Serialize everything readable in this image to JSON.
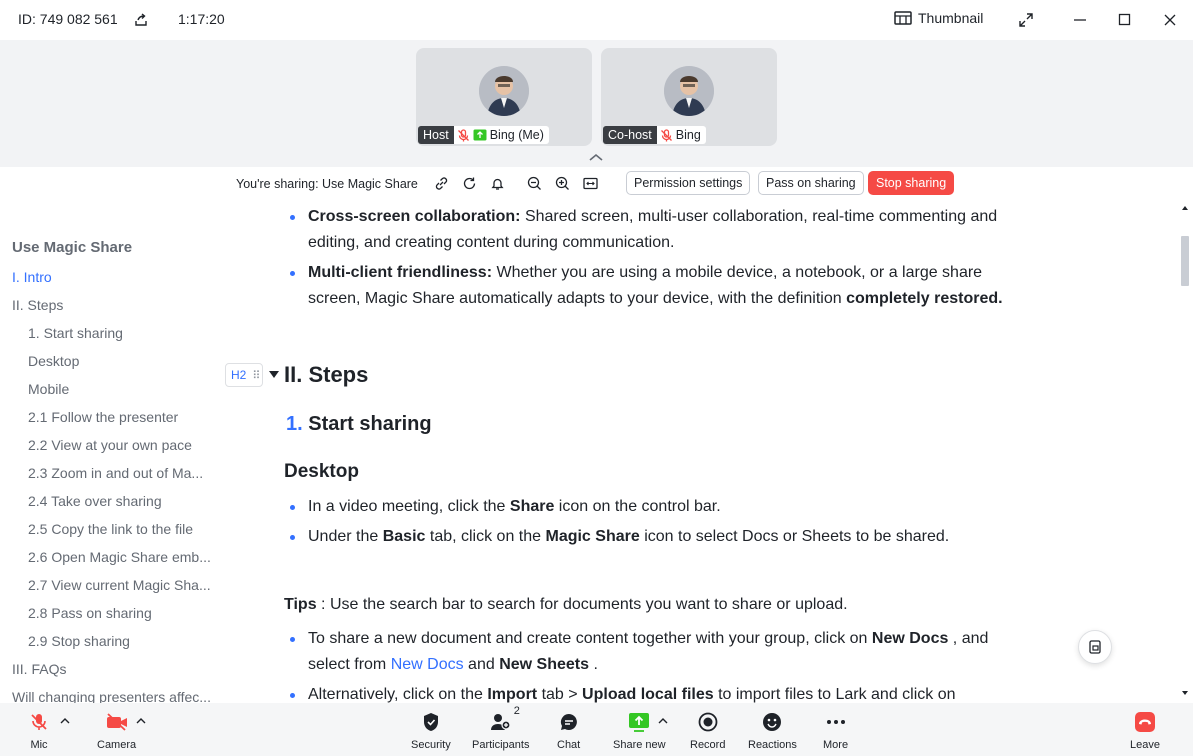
{
  "titlebar": {
    "meeting_id": "ID: 749 082 561",
    "timer": "1:17:20",
    "thumbnail_label": "Thumbnail"
  },
  "participants": [
    {
      "role": "Host",
      "name": "Bing (Me)"
    },
    {
      "role": "Co-host",
      "name": "Bing"
    }
  ],
  "sharebar": {
    "label": "You're sharing: Use Magic Share",
    "permission": "Permission settings",
    "pass_on": "Pass on sharing",
    "stop": "Stop sharing"
  },
  "toc": {
    "title": "Use Magic Share",
    "items": [
      "I. Intro",
      "II. Steps",
      "1. Start sharing",
      "Desktop",
      "Mobile",
      "2.1 Follow the presenter",
      "2.2 View at your own pace",
      "2.3 Zoom in and out of Ma...",
      "2.4 Take over sharing",
      "2.5 Copy the link to the file",
      "2.6 Open Magic Share emb...",
      "2.7 View current Magic Sha...",
      "2.8 Pass on sharing",
      "2.9 Stop sharing",
      "III. FAQs",
      "Will changing presenters affec..."
    ]
  },
  "doc": {
    "b1_strong": "Cross-screen collaboration:",
    "b1_text": " Shared screen, multi-user collaboration, real-time commenting and editing, and creating content during communication.",
    "b2_strong": "Multi-client friendliness:",
    "b2_text": " Whether you are using a mobile device, a notebook, or a large share screen, Magic Share automatically adapts to your device, with the definition ",
    "b2_strong2": "completely restored.",
    "heading_mark": "H2",
    "h_steps": "II. Steps",
    "h_start_num": "1.",
    "h_start": "Start sharing",
    "h_desktop": "Desktop",
    "d1_a": "In a video meeting, click the ",
    "d1_b": "Share",
    "d1_c": " icon on the control bar.",
    "d2_a": "Under the ",
    "d2_b": "Basic",
    "d2_c": " tab, click on the ",
    "d2_d": "Magic Share",
    "d2_e": " icon to select Docs or Sheets to be shared.",
    "tips_a": "Tips",
    "tips_b": " : Use the search bar to search for documents you want to share or upload.",
    "t1_a": "To share a new document and create content together with your group, click on ",
    "t1_b": "New Docs",
    "t1_c": " , and select from ",
    "t1_d": "New Docs",
    "t1_e": " and ",
    "t1_f": "New Sheets",
    "t1_g": " .",
    "t2_a": "Alternatively, click on the ",
    "t2_b": "Import",
    "t2_c": " tab > ",
    "t2_d": "Upload local files",
    "t2_e": " to import files to Lark and click on"
  },
  "toolbar": {
    "mic": "Mic",
    "camera": "Camera",
    "security": "Security",
    "participants": "Participants",
    "participants_count": "2",
    "chat": "Chat",
    "share_new": "Share new",
    "record": "Record",
    "reactions": "Reactions",
    "more": "More",
    "leave": "Leave"
  },
  "colors": {
    "accent": "#3370ff",
    "stop": "#f54a45",
    "share_green": "#34c724",
    "muted_red": "#f54a45"
  }
}
